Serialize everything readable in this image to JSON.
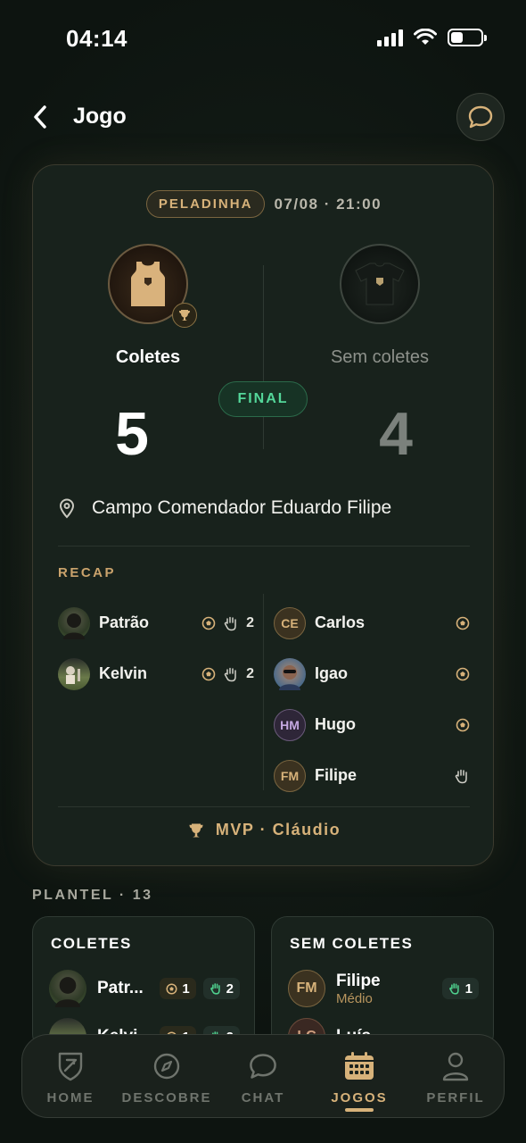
{
  "status_bar": {
    "time": "04:14"
  },
  "header": {
    "title": "Jogo"
  },
  "match": {
    "type": "PELADINHA",
    "datetime": "07/08 · 21:00",
    "status": "FINAL",
    "home": {
      "name": "Coletes",
      "score": "5"
    },
    "away": {
      "name": "Sem coletes",
      "score": "4"
    },
    "location": "Campo Comendador Eduardo Filipe"
  },
  "recap": {
    "title": "RECAP",
    "home_players": [
      {
        "name": "Patrão",
        "saves": "2"
      },
      {
        "name": "Kelvin",
        "saves": "2"
      }
    ],
    "away_players": [
      {
        "name": "Carlos",
        "initials": "CE"
      },
      {
        "name": "Igao"
      },
      {
        "name": "Hugo",
        "initials": "HM"
      },
      {
        "name": "Filipe",
        "initials": "FM"
      }
    ],
    "mvp": "MVP · Cláudio"
  },
  "squad": {
    "title": "PLANTEL · 13",
    "home": {
      "title": "COLETES",
      "players": [
        {
          "name": "Patr...",
          "goals": "1",
          "saves": "2"
        },
        {
          "name": "Kelvi...",
          "goals": "1",
          "saves": "2"
        }
      ]
    },
    "away": {
      "title": "SEM COLETES",
      "players": [
        {
          "name": "Filipe",
          "initials": "FM",
          "role": "Médio",
          "saves": "1"
        },
        {
          "name": "Luís",
          "initials": "LC"
        }
      ]
    }
  },
  "tabs": [
    {
      "label": "HOME"
    },
    {
      "label": "DESCOBRE"
    },
    {
      "label": "CHAT"
    },
    {
      "label": "JOGOS"
    },
    {
      "label": "PERFIL"
    }
  ],
  "colors": {
    "accent_gold": "#d7b27a",
    "final_green": "#54d79a",
    "background": "#0f1612"
  }
}
